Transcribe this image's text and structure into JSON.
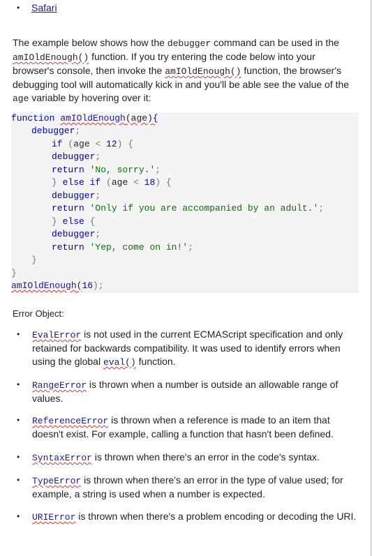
{
  "top_list": {
    "item": "Safari"
  },
  "intro": {
    "p1": "The example below shows how the ",
    "c1": "debugger",
    "p2": " command can be used in the ",
    "c2": "amIOldEnough()",
    "p3": " function. If you try entering the code below into your browser's console, then invoke the ",
    "c3": "amIOldEnough()",
    "p4": " function, the browser's debugging tool will automatically kick in and you'll be able see the value of the ",
    "c4": "age",
    "p5": " variable by hovering over it:"
  },
  "code": {
    "l1_kw": "function",
    "l1_fn": "amIOldEnough",
    "l1_rest": "(age)",
    "l1_brace": "{",
    "l2": "debugger",
    "l3_if": "if",
    "l3_open": " (",
    "l3_var": "age",
    "l3_op": " < ",
    "l3_num": "12",
    "l3_close": ") {",
    "l4": "debugger",
    "l5_kw": "return",
    "l5_str": "'No, sorry.'",
    "l6_close": "} ",
    "l6_else": "else",
    "l6_if": " if",
    "l6_open": " (",
    "l6_var": "age",
    "l6_op": " < ",
    "l6_num": "18",
    "l6_end": ") {",
    "l7": "debugger",
    "l8_kw": "return",
    "l8_str": "'Only if you are accompanied by an adult.'",
    "l9_close": "} ",
    "l9_else": "else",
    "l9_end": " {",
    "l10": "debugger",
    "l11_kw": "return",
    "l11_str": "'Yep, come on in!'",
    "l12": "}",
    "l13": "}",
    "l14_fn": "amIOldEnough",
    "l14_open": "(",
    "l14_num": "16",
    "l14_end": ");",
    "semi": ";",
    "comma_semi": ";"
  },
  "error_heading": "Error Object:",
  "errors": [
    {
      "name": "EvalError",
      "text": " is not used in the current ECMAScript specification and only retained for backwards compatibility. It was used to identify errors when using the global ",
      "code": "eval()",
      "tail": " function."
    },
    {
      "name": "RangeError",
      "text": " is thrown when a number is outside an allowable range of values."
    },
    {
      "name": "ReferenceError",
      "text": " is thrown when a reference is made to an item that doesn't exist. For example, calling a function that hasn't been defined."
    },
    {
      "name": "SyntaxError",
      "text": " is thrown when there's an error in the code's syntax."
    },
    {
      "name": "TypeError",
      "text": " is thrown when there's an error in the type of value used; for example, a string is used when a number is expected."
    },
    {
      "name": "URIError",
      "text": " is thrown when there's a problem encoding or decoding the URI."
    }
  ]
}
